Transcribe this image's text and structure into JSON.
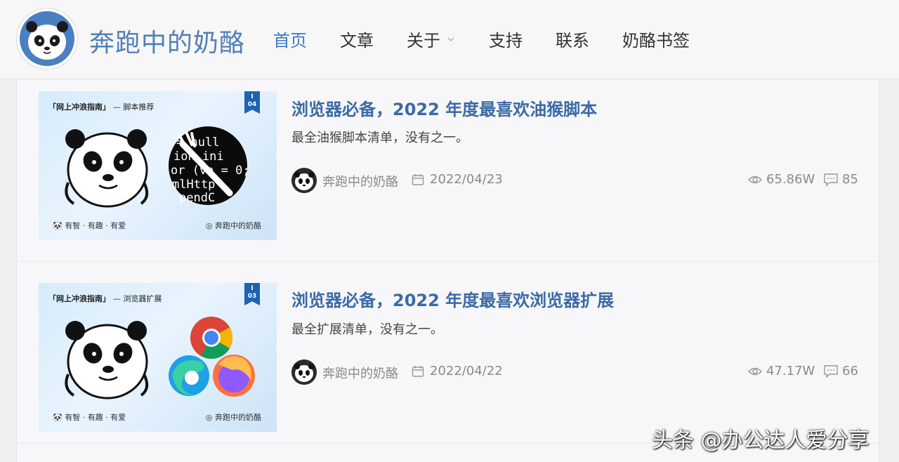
{
  "site": {
    "title": "奔跑中的奶酪"
  },
  "nav": {
    "items": [
      {
        "label": "首页",
        "active": true
      },
      {
        "label": "文章"
      },
      {
        "label": "关于",
        "has_dropdown": true
      },
      {
        "label": "支持"
      },
      {
        "label": "联系"
      },
      {
        "label": "奶酪书签"
      }
    ]
  },
  "articles": [
    {
      "title": "浏览器必备，2022 年度最喜欢油猴脚本",
      "excerpt": "最全油猴脚本清单，没有之一。",
      "author": "奔跑中的奶酪",
      "date": "2022/04/23",
      "views": "65.86W",
      "comments": "85",
      "thumb": {
        "tag": "「网上冲浪指南」",
        "tag_sub": "— 脚本推荐",
        "ribbon_num": "04",
        "ribbon_roman": "I",
        "foot_left": "有智 · 有趣 · 有爱",
        "foot_right": "奔跑中的奶酪",
        "code_lines": [
          "= null",
          "ion ini",
          "or (va",
          "i = 0;",
          "mlHttp",
          "pendC"
        ]
      }
    },
    {
      "title": "浏览器必备，2022 年度最喜欢浏览器扩展",
      "excerpt": "最全扩展清单，没有之一。",
      "author": "奔跑中的奶酪",
      "date": "2022/04/22",
      "views": "47.17W",
      "comments": "66",
      "thumb": {
        "tag": "「网上冲浪指南」",
        "tag_sub": "— 浏览器扩展",
        "ribbon_num": "03",
        "ribbon_roman": "I",
        "foot_left": "有智 · 有趣 · 有爱",
        "foot_right": "奔跑中的奶酪"
      }
    }
  ],
  "watermark": "头条 @办公达人爱分享",
  "colors": {
    "accent": "#3c78c9",
    "title": "#3b6aa6",
    "logo_bg": "#4a7fc0",
    "ribbon": "#1e62b4"
  }
}
